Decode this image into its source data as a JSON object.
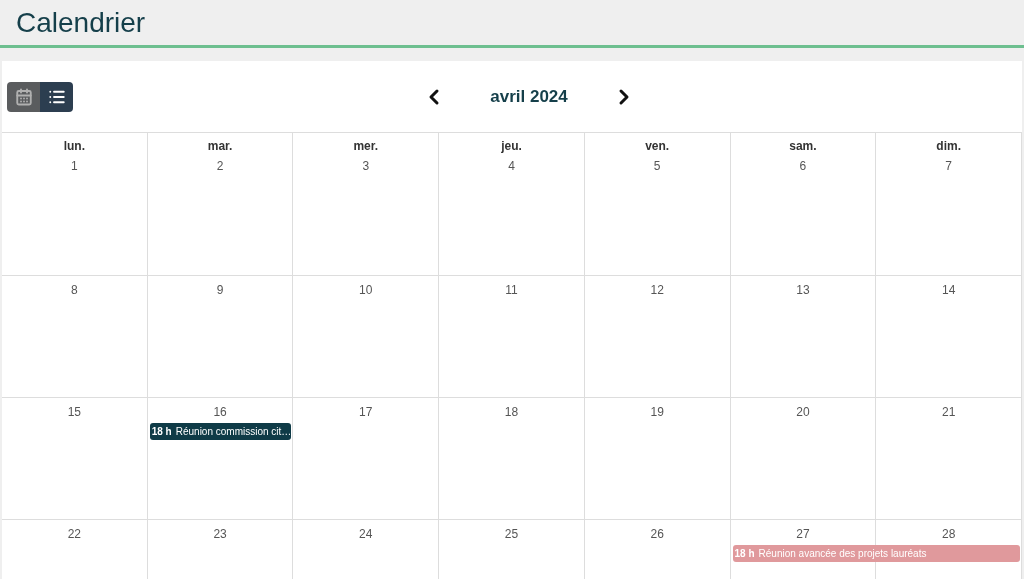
{
  "page_title": "Calendrier",
  "view_buttons": [
    {
      "kind": "calendar",
      "selected": false
    },
    {
      "kind": "list",
      "selected": true
    }
  ],
  "month": {
    "label": "avril 2024"
  },
  "weekdays": [
    "lun.",
    "mar.",
    "mer.",
    "jeu.",
    "ven.",
    "sam.",
    "dim."
  ],
  "weeks": [
    {
      "days": [
        {
          "number": "1"
        },
        {
          "number": "2"
        },
        {
          "number": "3"
        },
        {
          "number": "4"
        },
        {
          "number": "5"
        },
        {
          "number": "6"
        },
        {
          "number": "7"
        }
      ]
    },
    {
      "days": [
        {
          "number": "8"
        },
        {
          "number": "9"
        },
        {
          "number": "10"
        },
        {
          "number": "11"
        },
        {
          "number": "12"
        },
        {
          "number": "13"
        },
        {
          "number": "14"
        }
      ]
    },
    {
      "days": [
        {
          "number": "15"
        },
        {
          "number": "16",
          "events": [
            {
              "time": "18 h",
              "title": "Réunion commission cit…",
              "color": "#0f3b47",
              "multi_day": false
            }
          ]
        },
        {
          "number": "17"
        },
        {
          "number": "18"
        },
        {
          "number": "19"
        },
        {
          "number": "20"
        },
        {
          "number": "21"
        }
      ]
    },
    {
      "days": [
        {
          "number": "22"
        },
        {
          "number": "23"
        },
        {
          "number": "24"
        },
        {
          "number": "25"
        },
        {
          "number": "26"
        },
        {
          "number": "27",
          "events": [
            {
              "time": "18 h",
              "title": "Réunion avancée des projets lauréats",
              "color": "#e0999c",
              "multi_day": true
            }
          ]
        },
        {
          "number": "28"
        }
      ]
    }
  ]
}
